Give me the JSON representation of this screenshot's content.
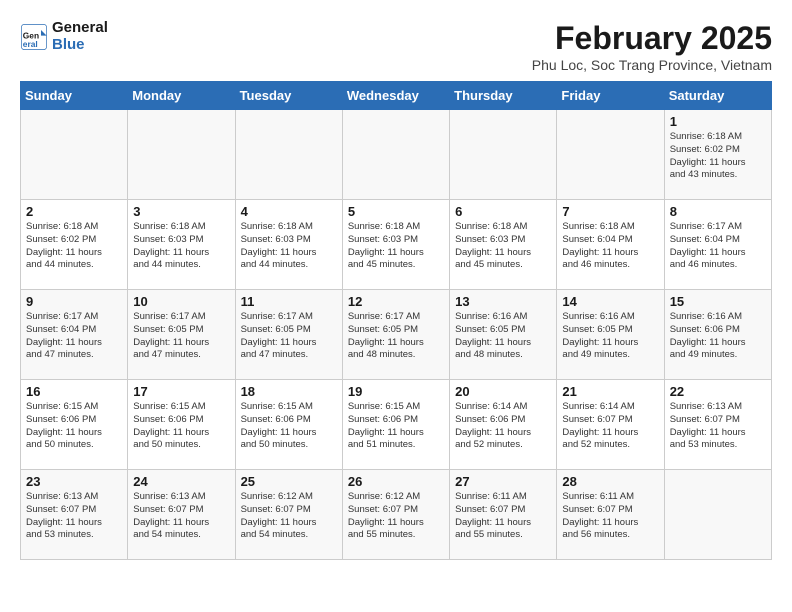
{
  "logo": {
    "line1": "General",
    "line2": "Blue"
  },
  "title": "February 2025",
  "location": "Phu Loc, Soc Trang Province, Vietnam",
  "days_of_week": [
    "Sunday",
    "Monday",
    "Tuesday",
    "Wednesday",
    "Thursday",
    "Friday",
    "Saturday"
  ],
  "weeks": [
    [
      {
        "day": "",
        "info": ""
      },
      {
        "day": "",
        "info": ""
      },
      {
        "day": "",
        "info": ""
      },
      {
        "day": "",
        "info": ""
      },
      {
        "day": "",
        "info": ""
      },
      {
        "day": "",
        "info": ""
      },
      {
        "day": "1",
        "info": "Sunrise: 6:18 AM\nSunset: 6:02 PM\nDaylight: 11 hours\nand 43 minutes."
      }
    ],
    [
      {
        "day": "2",
        "info": "Sunrise: 6:18 AM\nSunset: 6:02 PM\nDaylight: 11 hours\nand 44 minutes."
      },
      {
        "day": "3",
        "info": "Sunrise: 6:18 AM\nSunset: 6:03 PM\nDaylight: 11 hours\nand 44 minutes."
      },
      {
        "day": "4",
        "info": "Sunrise: 6:18 AM\nSunset: 6:03 PM\nDaylight: 11 hours\nand 44 minutes."
      },
      {
        "day": "5",
        "info": "Sunrise: 6:18 AM\nSunset: 6:03 PM\nDaylight: 11 hours\nand 45 minutes."
      },
      {
        "day": "6",
        "info": "Sunrise: 6:18 AM\nSunset: 6:03 PM\nDaylight: 11 hours\nand 45 minutes."
      },
      {
        "day": "7",
        "info": "Sunrise: 6:18 AM\nSunset: 6:04 PM\nDaylight: 11 hours\nand 46 minutes."
      },
      {
        "day": "8",
        "info": "Sunrise: 6:17 AM\nSunset: 6:04 PM\nDaylight: 11 hours\nand 46 minutes."
      }
    ],
    [
      {
        "day": "9",
        "info": "Sunrise: 6:17 AM\nSunset: 6:04 PM\nDaylight: 11 hours\nand 47 minutes."
      },
      {
        "day": "10",
        "info": "Sunrise: 6:17 AM\nSunset: 6:05 PM\nDaylight: 11 hours\nand 47 minutes."
      },
      {
        "day": "11",
        "info": "Sunrise: 6:17 AM\nSunset: 6:05 PM\nDaylight: 11 hours\nand 47 minutes."
      },
      {
        "day": "12",
        "info": "Sunrise: 6:17 AM\nSunset: 6:05 PM\nDaylight: 11 hours\nand 48 minutes."
      },
      {
        "day": "13",
        "info": "Sunrise: 6:16 AM\nSunset: 6:05 PM\nDaylight: 11 hours\nand 48 minutes."
      },
      {
        "day": "14",
        "info": "Sunrise: 6:16 AM\nSunset: 6:05 PM\nDaylight: 11 hours\nand 49 minutes."
      },
      {
        "day": "15",
        "info": "Sunrise: 6:16 AM\nSunset: 6:06 PM\nDaylight: 11 hours\nand 49 minutes."
      }
    ],
    [
      {
        "day": "16",
        "info": "Sunrise: 6:15 AM\nSunset: 6:06 PM\nDaylight: 11 hours\nand 50 minutes."
      },
      {
        "day": "17",
        "info": "Sunrise: 6:15 AM\nSunset: 6:06 PM\nDaylight: 11 hours\nand 50 minutes."
      },
      {
        "day": "18",
        "info": "Sunrise: 6:15 AM\nSunset: 6:06 PM\nDaylight: 11 hours\nand 50 minutes."
      },
      {
        "day": "19",
        "info": "Sunrise: 6:15 AM\nSunset: 6:06 PM\nDaylight: 11 hours\nand 51 minutes."
      },
      {
        "day": "20",
        "info": "Sunrise: 6:14 AM\nSunset: 6:06 PM\nDaylight: 11 hours\nand 52 minutes."
      },
      {
        "day": "21",
        "info": "Sunrise: 6:14 AM\nSunset: 6:07 PM\nDaylight: 11 hours\nand 52 minutes."
      },
      {
        "day": "22",
        "info": "Sunrise: 6:13 AM\nSunset: 6:07 PM\nDaylight: 11 hours\nand 53 minutes."
      }
    ],
    [
      {
        "day": "23",
        "info": "Sunrise: 6:13 AM\nSunset: 6:07 PM\nDaylight: 11 hours\nand 53 minutes."
      },
      {
        "day": "24",
        "info": "Sunrise: 6:13 AM\nSunset: 6:07 PM\nDaylight: 11 hours\nand 54 minutes."
      },
      {
        "day": "25",
        "info": "Sunrise: 6:12 AM\nSunset: 6:07 PM\nDaylight: 11 hours\nand 54 minutes."
      },
      {
        "day": "26",
        "info": "Sunrise: 6:12 AM\nSunset: 6:07 PM\nDaylight: 11 hours\nand 55 minutes."
      },
      {
        "day": "27",
        "info": "Sunrise: 6:11 AM\nSunset: 6:07 PM\nDaylight: 11 hours\nand 55 minutes."
      },
      {
        "day": "28",
        "info": "Sunrise: 6:11 AM\nSunset: 6:07 PM\nDaylight: 11 hours\nand 56 minutes."
      },
      {
        "day": "",
        "info": ""
      }
    ]
  ]
}
